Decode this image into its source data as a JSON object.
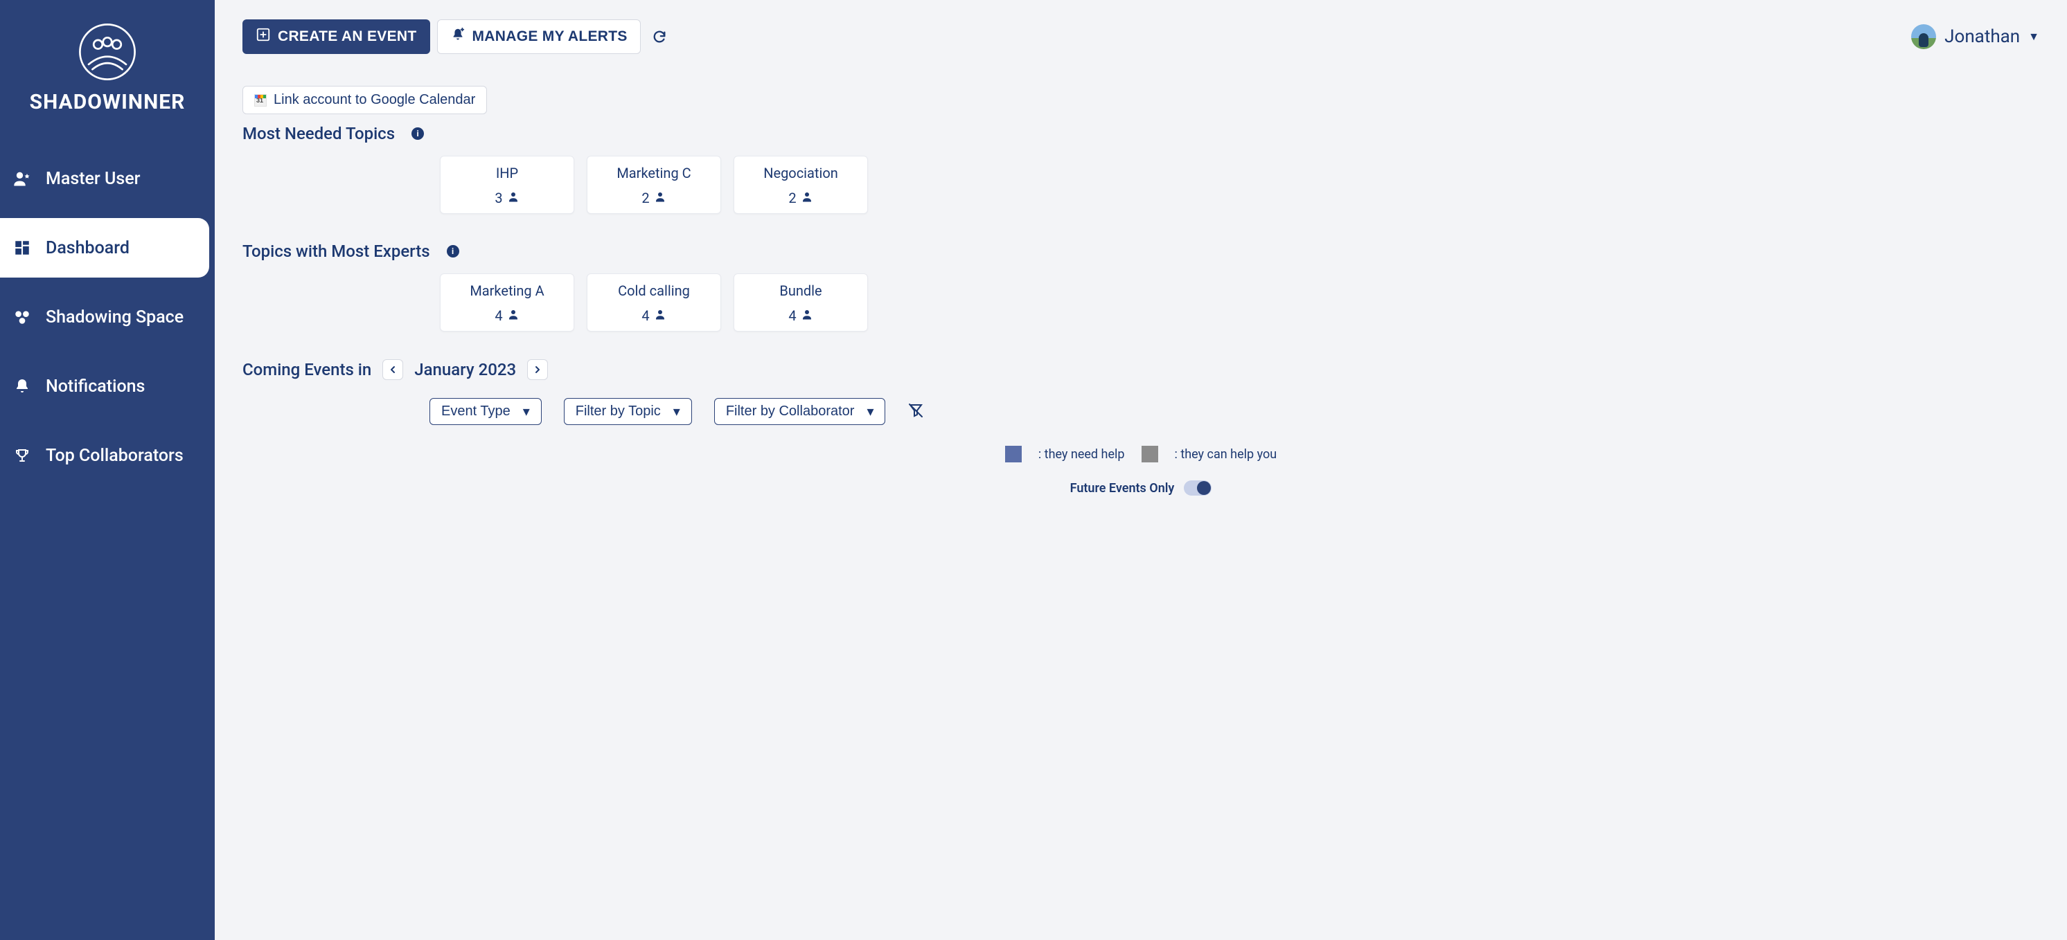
{
  "app": {
    "name": "SHADOWINNER"
  },
  "sidebar": {
    "items": [
      {
        "label": "Master User"
      },
      {
        "label": "Dashboard"
      },
      {
        "label": "Shadowing Space"
      },
      {
        "label": "Notifications"
      },
      {
        "label": "Top Collaborators"
      }
    ]
  },
  "topbar": {
    "create_label": "CREATE AN EVENT",
    "alerts_label": "MANAGE MY ALERTS",
    "user_name": "Jonathan"
  },
  "banner": {
    "link_gcal": "Link account to Google Calendar"
  },
  "sections": {
    "needed_title": "Most Needed Topics",
    "experts_title": "Topics with Most Experts",
    "needed": [
      {
        "name": "IHP",
        "count": "3"
      },
      {
        "name": "Marketing C",
        "count": "2"
      },
      {
        "name": "Negociation",
        "count": "2"
      }
    ],
    "experts": [
      {
        "name": "Marketing A",
        "count": "4"
      },
      {
        "name": "Cold calling",
        "count": "4"
      },
      {
        "name": "Bundle",
        "count": "4"
      }
    ]
  },
  "events": {
    "heading_prefix": "Coming Events in",
    "month": "January 2023",
    "filters": {
      "event_type": "Event Type",
      "by_topic": "Filter by Topic",
      "by_collab": "Filter by Collaborator"
    },
    "legend": {
      "need": ": they need help",
      "help": ": they can help you"
    },
    "toggle_label": "Future Events Only"
  }
}
